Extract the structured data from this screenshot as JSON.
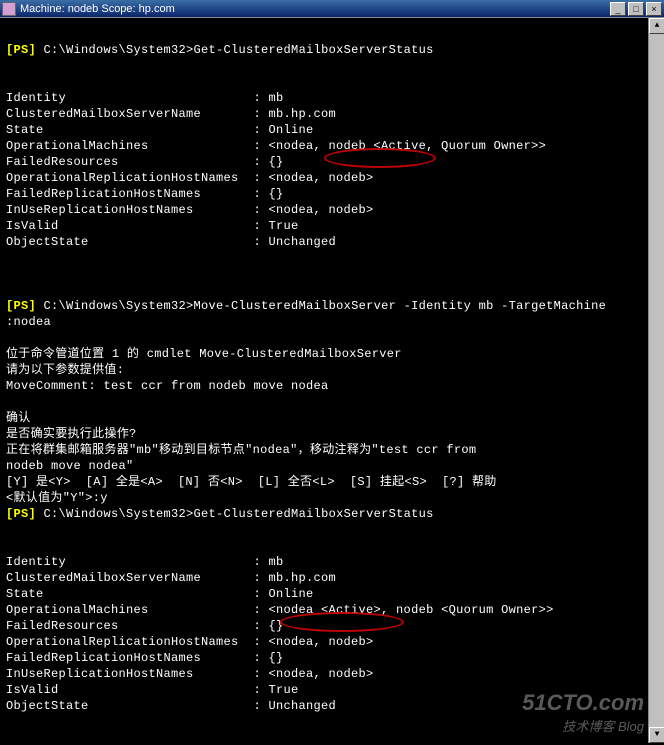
{
  "titlebar": {
    "machine_label": "Machine: ",
    "machine": "nodeb",
    "scope_label": "   Scope: ",
    "scope": "hp.com"
  },
  "window_buttons": {
    "min": "_",
    "max": "□",
    "close": "×"
  },
  "scroll": {
    "up": "▲",
    "down": "▼"
  },
  "session1": {
    "prompt_ps": "[PS] ",
    "path": "C:\\Windows\\System32>",
    "cmd": "Get-ClusteredMailboxServerStatus",
    "rows": [
      {
        "k": "Identity",
        "v": "mb"
      },
      {
        "k": "ClusteredMailboxServerName",
        "v": "mb.hp.com"
      },
      {
        "k": "State",
        "v": "Online"
      },
      {
        "k": "OperationalMachines",
        "v": "<nodea, nodeb <Active, Quorum Owner>>"
      },
      {
        "k": "FailedResources",
        "v": "{}"
      },
      {
        "k": "OperationalReplicationHostNames",
        "v": "<nodea, nodeb>"
      },
      {
        "k": "FailedReplicationHostNames",
        "v": "{}"
      },
      {
        "k": "InUseReplicationHostNames",
        "v": "<nodea, nodeb>"
      },
      {
        "k": "IsValid",
        "v": "True"
      },
      {
        "k": "ObjectState",
        "v": "Unchanged"
      }
    ]
  },
  "session2": {
    "prompt_ps": "[PS] ",
    "path": "C:\\Windows\\System32>",
    "cmd": "Move-ClusteredMailboxServer -Identity mb -TargetMachine",
    "cmd_cont": ":nodea",
    "msg1": "位于命令管道位置 1 的 cmdlet Move-ClusteredMailboxServer",
    "msg2": "请为以下参数提供值:",
    "move_comment_label": "MoveComment: ",
    "move_comment_val": "test ccr from nodeb move nodea",
    "confirm_hdr": "确认",
    "confirm_q": "是否确实要执行此操作?",
    "confirm_txt1": "正在将群集邮箱服务器\"mb\"移动到目标节点\"nodea\"，移动注释为\"test ccr from",
    "confirm_txt2": "nodeb move nodea\"",
    "options": "[Y] 是<Y>  [A] 全是<A>  [N] 否<N>  [L] 全否<L>  [S] 挂起<S>  [?] 帮助",
    "default_label": "<默认值为\"Y\">:",
    "answer": "y"
  },
  "session3": {
    "prompt_ps": "[PS] ",
    "path": "C:\\Windows\\System32>",
    "cmd": "Get-ClusteredMailboxServerStatus",
    "rows": [
      {
        "k": "Identity",
        "v": "mb"
      },
      {
        "k": "ClusteredMailboxServerName",
        "v": "mb.hp.com"
      },
      {
        "k": "State",
        "v": "Online"
      },
      {
        "k": "OperationalMachines",
        "v": "<nodea <Active>, nodeb <Quorum Owner>>"
      },
      {
        "k": "FailedResources",
        "v": "{}"
      },
      {
        "k": "OperationalReplicationHostNames",
        "v": "<nodea, nodeb>"
      },
      {
        "k": "FailedReplicationHostNames",
        "v": "{}"
      },
      {
        "k": "InUseReplicationHostNames",
        "v": "<nodea, nodeb>"
      },
      {
        "k": "IsValid",
        "v": "True"
      },
      {
        "k": "ObjectState",
        "v": "Unchanged"
      }
    ]
  },
  "watermark": {
    "brand": "51CTO.com",
    "sub": "技术博客      Blog"
  }
}
